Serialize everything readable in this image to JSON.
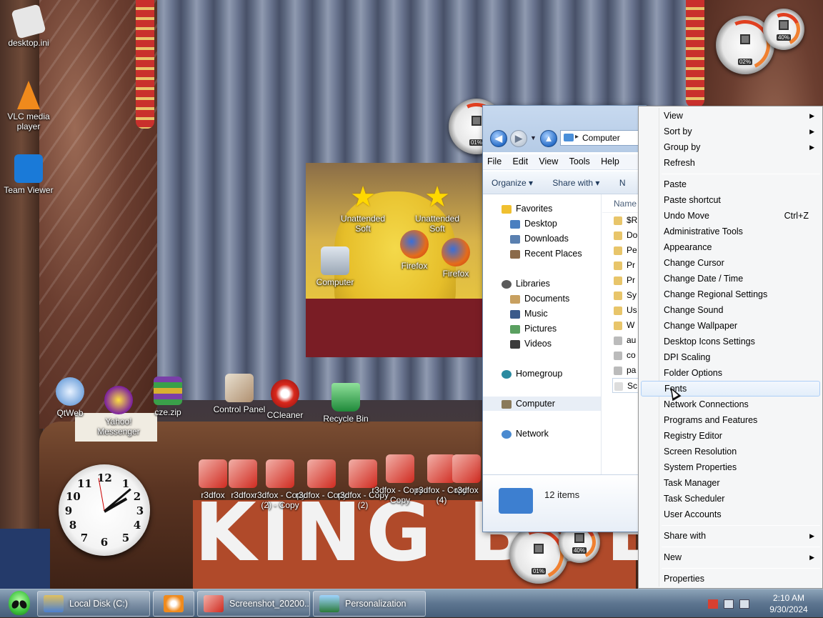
{
  "desktop": {
    "icons": [
      {
        "label": "desktop.ini",
        "icon": "ini-file-icon"
      },
      {
        "label": "VLC media player",
        "icon": "vlc-icon"
      },
      {
        "label": "Team Viewer",
        "icon": "teamviewer-icon"
      },
      {
        "label": "Unattended Soft",
        "icon": "star-icon"
      },
      {
        "label": "Unattended Soft",
        "icon": "star-icon"
      },
      {
        "label": "Firefox",
        "icon": "firefox-icon"
      },
      {
        "label": "Firefox",
        "icon": "firefox-icon"
      },
      {
        "label": "Computer",
        "icon": "computer-icon"
      },
      {
        "label": "QtWeb",
        "icon": "qtweb-icon"
      },
      {
        "label": "Yahoo! Messenger",
        "icon": "yahoo-icon"
      },
      {
        "label": "cze.zip",
        "icon": "zip-icon"
      },
      {
        "label": "Control Panel",
        "icon": "control-panel-icon"
      },
      {
        "label": "CCleaner",
        "icon": "ccleaner-icon"
      },
      {
        "label": "Recycle Bin",
        "icon": "recycle-bin-icon"
      },
      {
        "label": "r3dfox",
        "icon": "r3dfox-icon"
      },
      {
        "label": "r3dfox",
        "icon": "r3dfox-icon"
      },
      {
        "label": "r3dfox - Copy (2) - Copy",
        "icon": "r3dfox-icon"
      },
      {
        "label": "r3dfox - Copy",
        "icon": "r3dfox-icon"
      },
      {
        "label": "r3dfox - Copy (2)",
        "icon": "r3dfox-icon"
      },
      {
        "label": "r3dfox - Copy - Copy",
        "icon": "r3dfox-icon"
      },
      {
        "label": "r3dfox - Copy (4)",
        "icon": "r3dfox-icon"
      },
      {
        "label": "r3dfox",
        "icon": "r3dfox-icon"
      }
    ],
    "wallpaper_text": "KING BOB",
    "gauges": [
      {
        "value": "02%"
      },
      {
        "value": "40%"
      },
      {
        "value": "01%"
      },
      {
        "value": "01%"
      },
      {
        "value": "40%"
      }
    ]
  },
  "explorer": {
    "address": "Computer",
    "menu": [
      "File",
      "Edit",
      "View",
      "Tools",
      "Help"
    ],
    "commands": [
      "Organize ▾",
      "Share with ▾",
      "N"
    ],
    "nav": {
      "favorites": "Favorites",
      "desktop": "Desktop",
      "downloads": "Downloads",
      "recent": "Recent Places",
      "libraries": "Libraries",
      "documents": "Documents",
      "music": "Music",
      "pictures": "Pictures",
      "videos": "Videos",
      "homegroup": "Homegroup",
      "computer": "Computer",
      "network": "Network"
    },
    "column_header": "Name",
    "files": [
      "$R",
      "Do",
      "Pe",
      "Pr",
      "Pr",
      "Sy",
      "Us",
      "W",
      "au",
      "co",
      "pa",
      "Sc"
    ],
    "item_count": "12 items"
  },
  "context_menu": {
    "view": "View",
    "sort_by": "Sort by",
    "group_by": "Group by",
    "refresh": "Refresh",
    "paste": "Paste",
    "paste_shortcut": "Paste shortcut",
    "undo_move": "Undo Move",
    "undo_shortcut": "Ctrl+Z",
    "admin_tools": "Administrative Tools",
    "appearance": "Appearance",
    "change_cursor": "Change Cursor",
    "change_date_time": "Change Date / Time",
    "change_regional": "Change Regional Settings",
    "change_sound": "Change Sound",
    "change_wallpaper": "Change Wallpaper",
    "desktop_icons": "Desktop Icons Settings",
    "dpi_scaling": "DPI Scaling",
    "folder_options": "Folder Options",
    "fonts": "Fonts",
    "network_connections": "Network Connections",
    "programs_features": "Programs and Features",
    "registry_editor": "Registry Editor",
    "screen_resolution": "Screen Resolution",
    "system_properties": "System Properties",
    "task_manager": "Task Manager",
    "task_scheduler": "Task Scheduler",
    "user_accounts": "User Accounts",
    "share_with": "Share with",
    "new": "New",
    "properties": "Properties"
  },
  "taskbar": {
    "buttons": [
      {
        "label": "Local Disk (C:)",
        "icon": "drive-icon"
      },
      {
        "label": "",
        "icon": "media-player-icon"
      },
      {
        "label": "Screenshot_20200...",
        "icon": "r3dfox-icon"
      },
      {
        "label": "Personalization",
        "icon": "personalization-icon"
      }
    ],
    "time": "2:10 AM",
    "date": "9/30/2024"
  }
}
